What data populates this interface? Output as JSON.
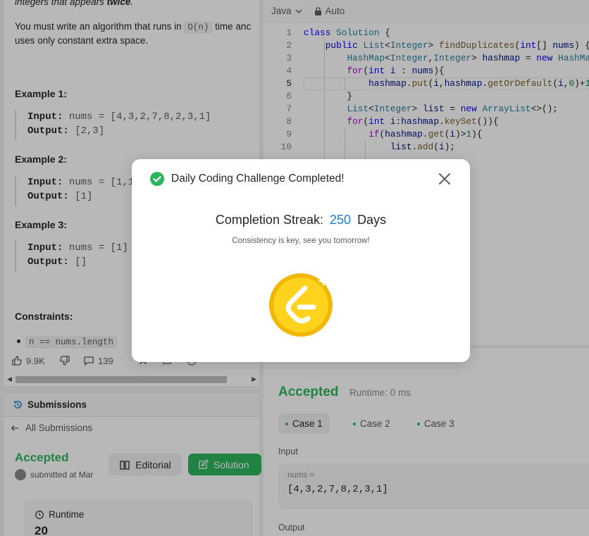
{
  "problem": {
    "intro_top": "integers that appears",
    "intro_top_bold": "twice",
    "req_line1_a": "You must write an algorithm that runs in",
    "req_inline": "O(n)",
    "req_line1_b": "time anc",
    "req_line2": "uses only constant extra space."
  },
  "examples": [
    {
      "title": "Example 1:",
      "input_label": "Input:",
      "input_value": "nums = [4,3,2,7,8,2,3,1]",
      "output_label": "Output:",
      "output_value": "[2,3]"
    },
    {
      "title": "Example 2:",
      "input_label": "Input:",
      "input_value": "nums = [1,1",
      "output_label": "Output:",
      "output_value": "[1]"
    },
    {
      "title": "Example 3:",
      "input_label": "Input:",
      "input_value": "nums = [1]",
      "output_label": "Output:",
      "output_value": "[]"
    }
  ],
  "constraints": {
    "title": "Constraints:",
    "item1": "n == nums.length"
  },
  "actions": {
    "likes": "9.9K",
    "comments": "139"
  },
  "submissions": {
    "header": "Submissions",
    "back_label": "All Submissions",
    "status": "Accepted",
    "submitted": "submitted at Mar",
    "editorial_label": "Editorial",
    "solution_label": "Solution",
    "runtime_label": "Runtime",
    "runtime_value": "20"
  },
  "editor": {
    "language": "Java",
    "mode": "Auto",
    "line_numbers": [
      "1",
      "2",
      "3",
      "4",
      "5",
      "6",
      "7",
      "8",
      "9",
      "10"
    ]
  },
  "result": {
    "status": "Accepted",
    "runtime": "Runtime: 0 ms",
    "cases": [
      "Case 1",
      "Case 2",
      "Case 3"
    ],
    "input_label": "Input",
    "input_var": "nums =",
    "input_value": "[4,3,2,7,8,2,3,1]",
    "output_label": "Output"
  },
  "modal": {
    "title": "Daily Coding Challenge Completed!",
    "streak_label": "Completion Streak:",
    "streak_count": "250",
    "streak_unit": "Days",
    "subtitle": "Consistency is key, see you tomorrow!"
  },
  "colors": {
    "accent_green": "#2db55d",
    "streak_blue": "#1a7fd6",
    "coin_gold": "#f5c518"
  },
  "icons": {
    "modal_status": "check-circle-icon",
    "modal_close": "close-icon",
    "coin": "leetcode-coin-icon"
  }
}
